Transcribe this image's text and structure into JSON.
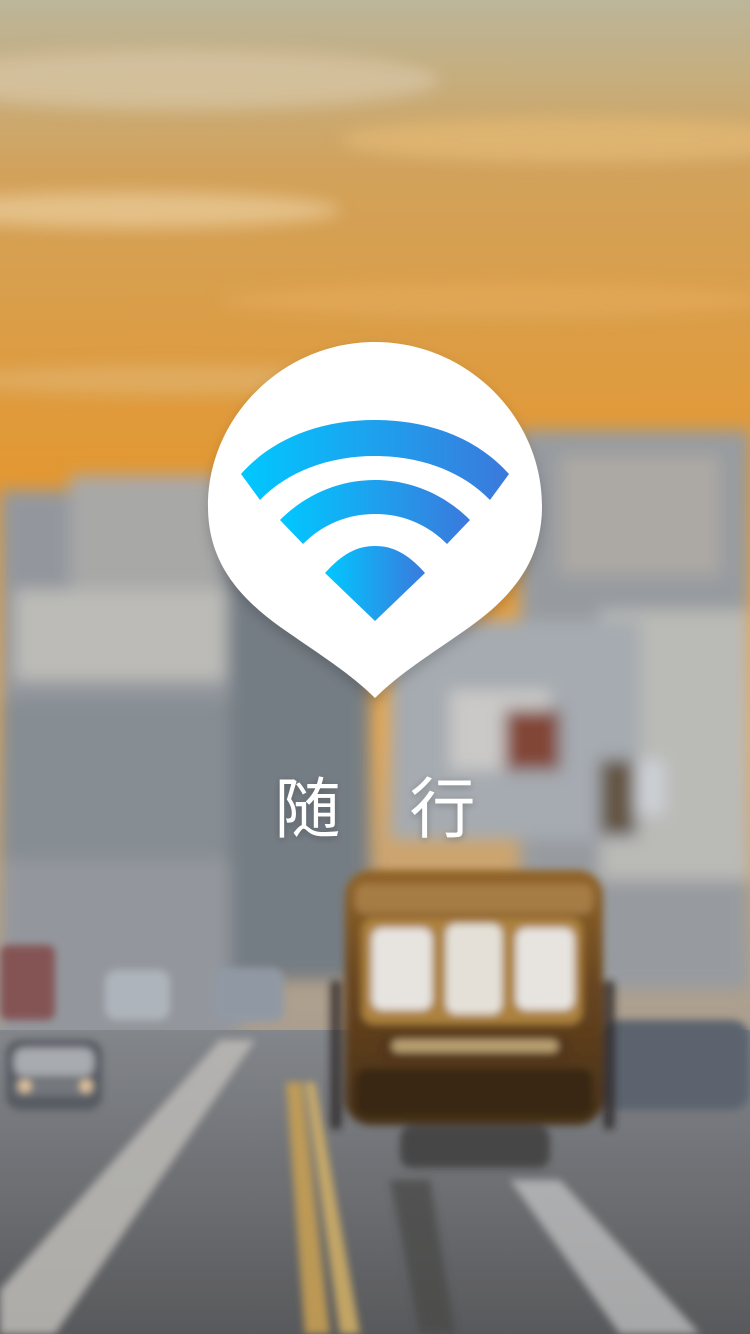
{
  "splash": {
    "app_name": "随 行",
    "background_scene": "blurred-street-cable-car-sunset",
    "logo_icon": "wifi-pin-icon"
  },
  "colors": {
    "sky_top": "#d9b27b",
    "sky_mid": "#f0a13a",
    "sky_low": "#f4b25a",
    "city_gray": "#8f949b",
    "street": "#6f7073",
    "pin_white": "#ffffff",
    "wifi_cyan": "#00c8ff",
    "wifi_blue": "#3b79dc",
    "cable_car_brown": "#6e4d2a",
    "app_name_text": "#ffffff"
  }
}
